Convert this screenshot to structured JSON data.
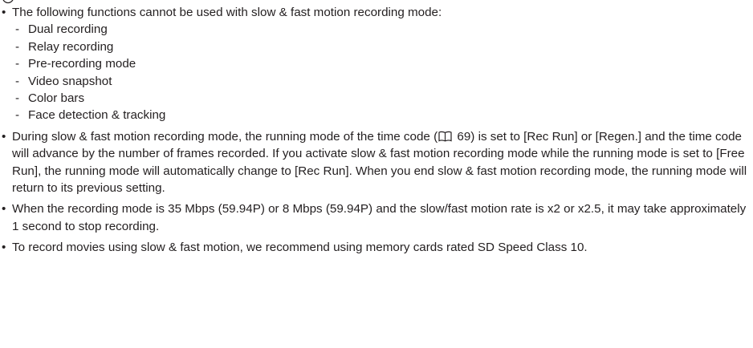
{
  "notes": {
    "item1": {
      "text": "The following functions cannot be used with slow & fast motion recording mode:",
      "subitems": [
        "Dual recording",
        "Relay recording",
        "Pre-recording mode",
        "Video snapshot",
        "Color bars",
        "Face detection & tracking"
      ]
    },
    "item2": {
      "before_ref": "During slow & fast motion recording mode, the running mode of the time code (",
      "ref_icon": "book-icon",
      "ref_page": "69",
      "after_ref": ") is set to [Rec Run] or [Regen.] and the time code will advance by the number of frames recorded. If you activate slow & fast motion recording mode while the running mode is set to [Free Run], the running mode will automatically change to [Rec Run]. When you end slow & fast motion recording mode, the running mode will return to its previous setting."
    },
    "item3": {
      "text": "When the recording mode is 35 Mbps (59.94P) or 8 Mbps (59.94P) and the slow/fast motion rate is x2 or x2.5, it may take approximately 1 second to stop recording."
    },
    "item4": {
      "text": "To record movies using slow & fast motion, we recommend using memory cards rated SD Speed Class 10."
    }
  },
  "icons": {
    "note": "note-icon",
    "bullet": "•",
    "dash": "-"
  }
}
